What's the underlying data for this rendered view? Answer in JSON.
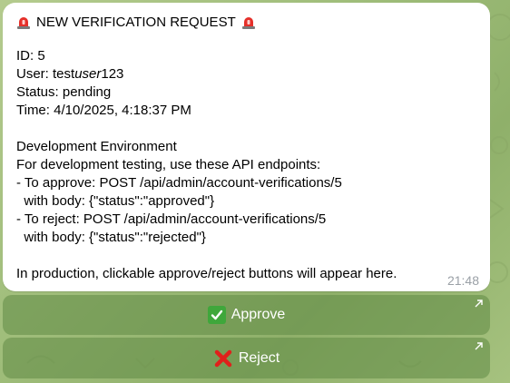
{
  "message": {
    "title": "NEW VERIFICATION REQUEST",
    "title_icon": "rotating-light-icon",
    "lines": [
      "ID: 5",
      "User: testuser123",
      "Status: pending",
      "Time: 4/10/2025, 4:18:37 PM",
      "",
      "Development Environment",
      "For development testing, use these API endpoints:",
      "- To approve: POST /api/admin/account-verifications/5",
      "  with body: {\"status\":\"approved\"}",
      "- To reject: POST /api/admin/account-verifications/5",
      "  with body: {\"status\":\"rejected\"}",
      "",
      "In production, clickable approve/reject buttons will appear here."
    ],
    "user_prefix": "User: test",
    "user_italic": "user",
    "user_suffix": "123",
    "timestamp": "21:48"
  },
  "buttons": {
    "approve": {
      "label": "Approve",
      "icon": "check-mark-button-icon",
      "color": "#3fa73b"
    },
    "reject": {
      "label": "Reject",
      "icon": "cross-mark-icon",
      "color": "#e0201b"
    }
  },
  "colors": {
    "background": "#9fbd7a",
    "bubble": "#ffffff",
    "timestamp": "#9aa0a6",
    "button": "#6b9050"
  }
}
